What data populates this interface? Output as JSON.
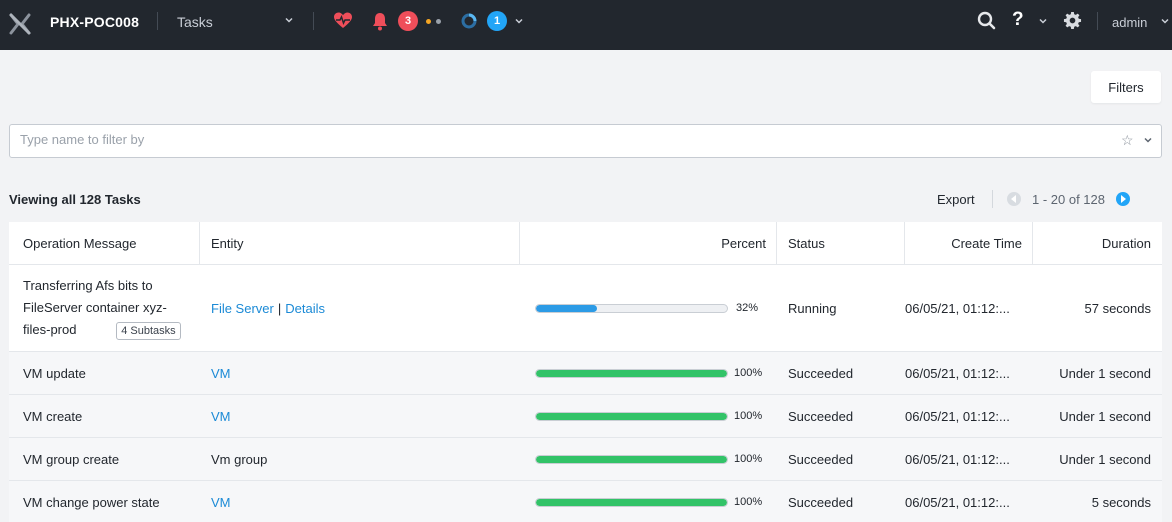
{
  "topbar": {
    "cluster_name": "PHX-POC008",
    "nav_label": "Tasks",
    "alerts_count": "3",
    "tasks_count": "1",
    "user": "admin"
  },
  "toolbar": {
    "filters_label": "Filters",
    "search_placeholder": "Type name to filter by",
    "viewing_label": "Viewing all 128 Tasks",
    "export_label": "Export",
    "page_range": "1 - 20 of 128"
  },
  "table": {
    "headers": {
      "operation": "Operation Message",
      "entity": "Entity",
      "percent": "Percent",
      "status": "Status",
      "create_time": "Create Time",
      "duration": "Duration"
    },
    "rows": [
      {
        "operation_lines": [
          "Transferring Afs bits to",
          "FileServer container xyz-",
          "files-prod"
        ],
        "subtasks": "4 Subtasks",
        "entity_link": "File Server",
        "entity_sep": "|",
        "entity_link2": "Details",
        "percent": 32,
        "percent_label": "32%",
        "status": "Running",
        "create_time": "06/05/21, 01:12:...",
        "duration": "57 seconds"
      },
      {
        "operation": "VM update",
        "entity_link": "VM",
        "percent": 100,
        "percent_label": "100%",
        "status": "Succeeded",
        "create_time": "06/05/21, 01:12:...",
        "duration": "Under 1 second"
      },
      {
        "operation": "VM create",
        "entity_link": "VM",
        "percent": 100,
        "percent_label": "100%",
        "status": "Succeeded",
        "create_time": "06/05/21, 01:12:...",
        "duration": "Under 1 second"
      },
      {
        "operation": "VM group create",
        "entity_text": "Vm group",
        "percent": 100,
        "percent_label": "100%",
        "status": "Succeeded",
        "create_time": "06/05/21, 01:12:...",
        "duration": "Under 1 second"
      },
      {
        "operation": "VM change power state",
        "entity_link": "VM",
        "percent": 100,
        "percent_label": "100%",
        "status": "Succeeded",
        "create_time": "06/05/21, 01:12:...",
        "duration": "5 seconds"
      }
    ]
  },
  "colors": {
    "topbar_bg": "#22272e",
    "accent_blue": "#22a5f7",
    "alert_red": "#ef4e5a",
    "progress_running": "#2c9be6",
    "progress_success": "#32c368"
  },
  "icons": [
    "x-logo-icon",
    "chevron-down-icon",
    "heartbeat-icon",
    "bell-icon",
    "status-dot-icon",
    "task-ring-icon",
    "search-icon",
    "help-icon",
    "gear-icon",
    "star-icon",
    "prev-page-icon",
    "next-page-icon"
  ]
}
